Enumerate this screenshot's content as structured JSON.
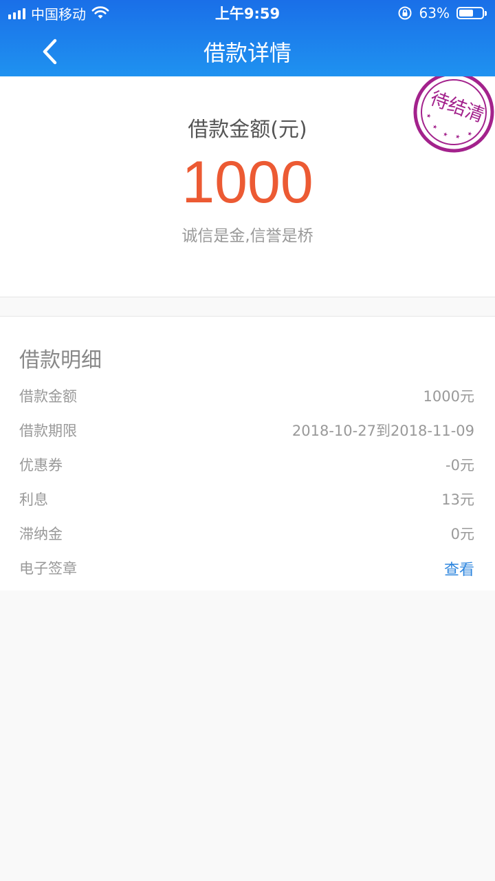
{
  "status_bar": {
    "carrier": "中国移动",
    "time": "上午9:59",
    "battery_percent_text": "63%",
    "battery_level": 0.63,
    "icons": [
      "signal-icon",
      "wifi-icon",
      "rotation-lock-icon",
      "battery-icon"
    ]
  },
  "nav": {
    "back_icon": "chevron-left-icon",
    "title": "借款详情"
  },
  "summary": {
    "label": "借款金额(元)",
    "amount": "1000",
    "slogan": "诚信是金,信誉是桥",
    "stamp_text": "待结清",
    "stamp_color": "#a3228c",
    "amount_color": "#ec5a33"
  },
  "detail": {
    "title": "借款明细",
    "rows": [
      {
        "label": "借款金额",
        "value": "1000元"
      },
      {
        "label": "借款期限",
        "value": "2018-10-27到2018-11-09"
      },
      {
        "label": "优惠券",
        "value": "-0元"
      },
      {
        "label": "利息",
        "value": "13元"
      },
      {
        "label": "滞纳金",
        "value": "0元"
      },
      {
        "label": "电子签章",
        "value": "查看"
      }
    ],
    "link_color": "#2e86de"
  },
  "colors": {
    "header_gradient_top": "#1a6fe8",
    "header_gradient_bottom": "#1f92f0",
    "page_background": "#f9f9f9"
  }
}
